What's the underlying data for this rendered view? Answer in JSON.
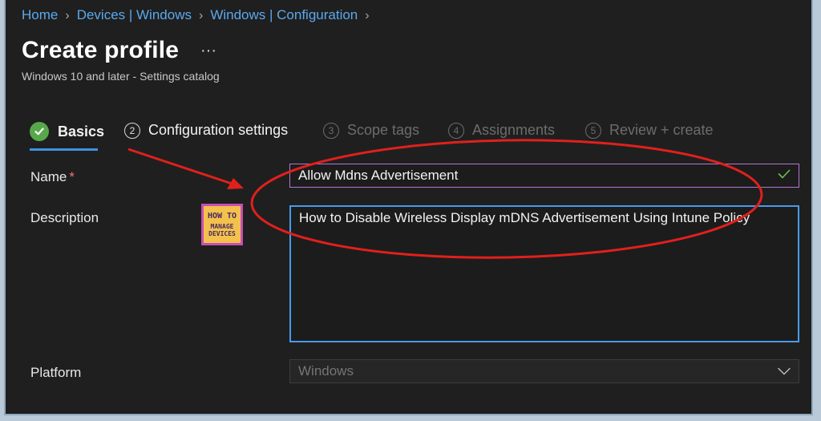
{
  "breadcrumb": {
    "items": [
      "Home",
      "Devices | Windows",
      "Windows | Configuration"
    ],
    "separator": ">"
  },
  "page": {
    "title": "Create profile",
    "more_label": "···",
    "subtitle": "Windows 10 and later - Settings catalog"
  },
  "steps": [
    {
      "number": "1",
      "label": "Basics",
      "state": "completed"
    },
    {
      "number": "2",
      "label": "Configuration settings",
      "state": "enabled"
    },
    {
      "number": "3",
      "label": "Scope tags",
      "state": "disabled"
    },
    {
      "number": "4",
      "label": "Assignments",
      "state": "disabled"
    },
    {
      "number": "5",
      "label": "Review + create",
      "state": "disabled"
    }
  ],
  "form": {
    "name_label": "Name",
    "required_marker": "*",
    "name_value": "Allow Mdns Advertisement",
    "description_label": "Description",
    "description_value": "How to Disable Wireless Display mDNS Advertisement Using Intune Policy",
    "platform_label": "Platform",
    "platform_value": "Windows"
  },
  "logo": {
    "line1": "HOW TO",
    "line2": "MANAGE",
    "line3": "DEVICES"
  },
  "icons": {
    "valid_check": "checkmark-icon",
    "dropdown": "chevron-down-icon",
    "breadcrumb_sep": "chevron-right-icon"
  },
  "colors": {
    "accent": "#3f91e0",
    "success": "#57a84b",
    "annotation": "#e0201c",
    "field_border": "#b478cf"
  }
}
